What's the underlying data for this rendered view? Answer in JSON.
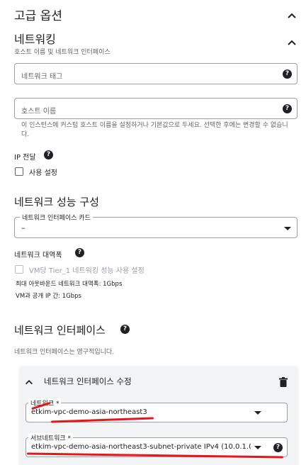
{
  "advanced": {
    "title": "고급 옵션"
  },
  "networking": {
    "title": "네트워킹",
    "subtitle": "호스트 이름 및 네트워크 인터페이스",
    "network_tags": {
      "placeholder": "네트워크 태그"
    },
    "hostname": {
      "placeholder": "호스트 이름",
      "hint": "이 인스턴스에 커스텀 호스트 이름을 설정하거나 기본값으로 두세요. 선택한 후에는 변경할 수 없습니다."
    },
    "ip_forwarding": {
      "label": "IP 전달",
      "checkbox_label": "사용 설정"
    }
  },
  "performance": {
    "title": "네트워크 성능 구성",
    "nic_card": {
      "label": "네트워크 인터페이스 카드",
      "value": "–"
    },
    "bandwidth": {
      "label": "네트워크 대역폭",
      "checkbox_label": "VM당 Tier_1 네트워킹 성능 사용 설정",
      "line1": "최대 아웃바운드 네트워크 대역폭: 1Gbps",
      "line2": "VM과 공개 IP 간: 1Gbps"
    }
  },
  "interfaces": {
    "title": "네트워크 인터페이스",
    "subtitle": "네트워크 인터페이스는 영구적입니다.",
    "edit_card": {
      "title": "네트워크 인터페이스 수정",
      "network": {
        "label": "네트워크 *",
        "value": "etkim-vpc-demo-asia-northeast3"
      },
      "subnet": {
        "label": "서브네트워크 *",
        "value": "etkim-vpc-demo-asia-northeast3-subnet-private IPv4 (10.0.1.0/..."
      }
    }
  },
  "colors": {
    "annotation": "#e8151b",
    "card_bg": "#f1f3f4"
  }
}
